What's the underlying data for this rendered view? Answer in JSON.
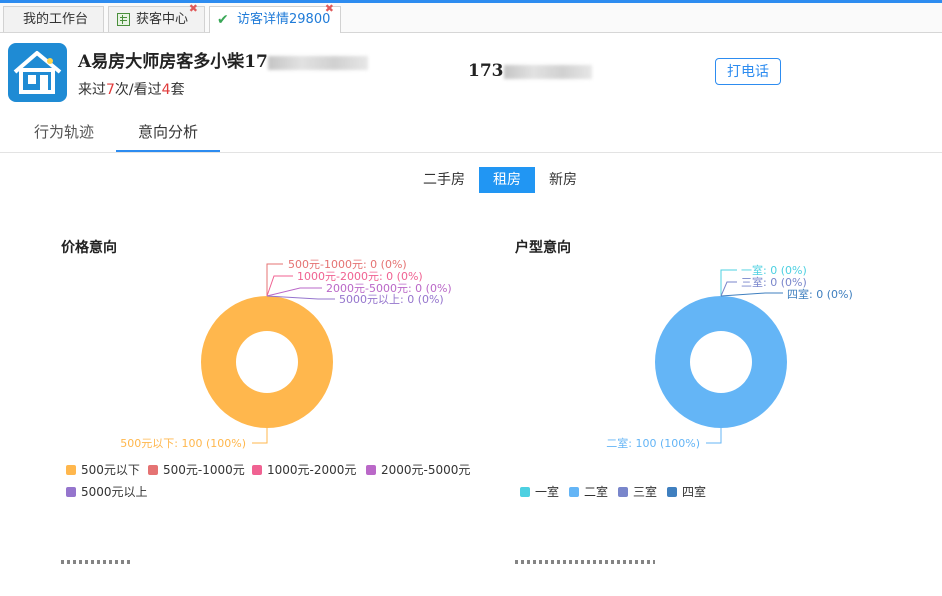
{
  "tabs": [
    {
      "label": "我的工作台",
      "closable": false
    },
    {
      "label": "获客中心",
      "closable": true
    },
    {
      "label": "访客详情29800",
      "closable": true
    }
  ],
  "customer": {
    "name_prefix": "A易房大师房客多小柴17",
    "visits_prefix": "来过",
    "visits_count": "7",
    "visits_mid": "次/看过",
    "viewed_count": "4",
    "visits_suffix": "套",
    "phone_prefix": "173",
    "call_label": "打电话"
  },
  "subtabs": [
    "行为轨迹",
    "意向分析"
  ],
  "segments": {
    "items": [
      "二手房",
      "租房",
      "新房"
    ],
    "active": "租房"
  },
  "price_chart": {
    "title": "价格意向",
    "chart_data": {
      "type": "pie",
      "categories": [
        "500元以下",
        "500元-1000元",
        "1000元-2000元",
        "2000元-5000元",
        "5000元以上"
      ],
      "values": [
        100,
        0,
        0,
        0,
        0
      ],
      "percents": [
        100,
        0,
        0,
        0,
        0
      ],
      "colors": [
        "#ffb74d",
        "#e57373",
        "#f06292",
        "#ba68c8",
        "#9575cd"
      ],
      "labels": [
        "500元以下: 100 (100%)",
        "500元-1000元: 0 (0%)",
        "1000元-2000元: 0 (0%)",
        "2000元-5000元: 0 (0%)",
        "5000元以上: 0 (0%)"
      ]
    }
  },
  "room_chart": {
    "title": "户型意向",
    "chart_data": {
      "type": "pie",
      "categories": [
        "一室",
        "二室",
        "三室",
        "四室"
      ],
      "values": [
        0,
        100,
        0,
        0
      ],
      "percents": [
        0,
        100,
        0,
        0
      ],
      "colors": [
        "#4dd0e1",
        "#64b5f6",
        "#7986cb",
        "#3f7fbf"
      ],
      "labels": [
        "一室: 0 (0%)",
        "二室: 100 (100%)",
        "三室: 0 (0%)",
        "四室: 0 (0%)"
      ]
    }
  }
}
